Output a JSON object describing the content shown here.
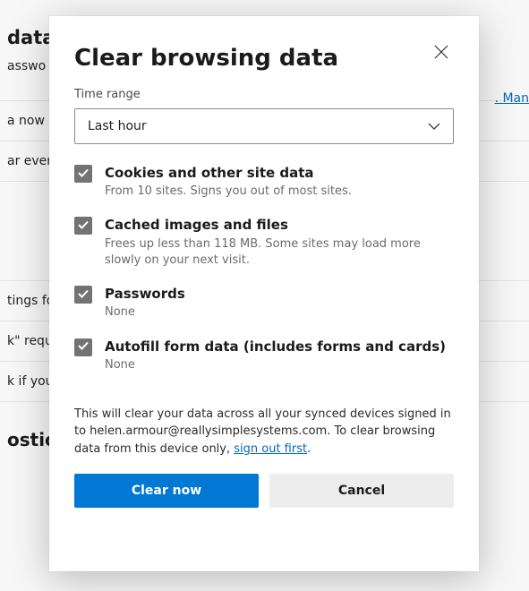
{
  "background": {
    "title_fragment": "data",
    "sub_fragment": "asswo",
    "link_fragment": ". Man",
    "rows": [
      "a now",
      "ar ever",
      "tings fo",
      "k\" requ",
      "k if you"
    ],
    "heading2_fragment": "ostic data"
  },
  "modal": {
    "title": "Clear browsing data",
    "time_range_label": "Time range",
    "time_range_value": "Last hour",
    "items": [
      {
        "title": "Cookies and other site data",
        "sub": "From 10 sites. Signs you out of most sites."
      },
      {
        "title": "Cached images and files",
        "sub": "Frees up less than 118 MB. Some sites may load more slowly on your next visit."
      },
      {
        "title": "Passwords",
        "sub": "None"
      },
      {
        "title": "Autofill form data (includes forms and cards)",
        "sub": "None"
      }
    ],
    "footer_text_1": "This will clear your data across all your synced devices signed in to helen.armour@reallysimplesystems.com. To clear browsing data from this device only, ",
    "footer_link": "sign out first",
    "footer_text_2": ".",
    "primary_btn": "Clear now",
    "secondary_btn": "Cancel"
  }
}
